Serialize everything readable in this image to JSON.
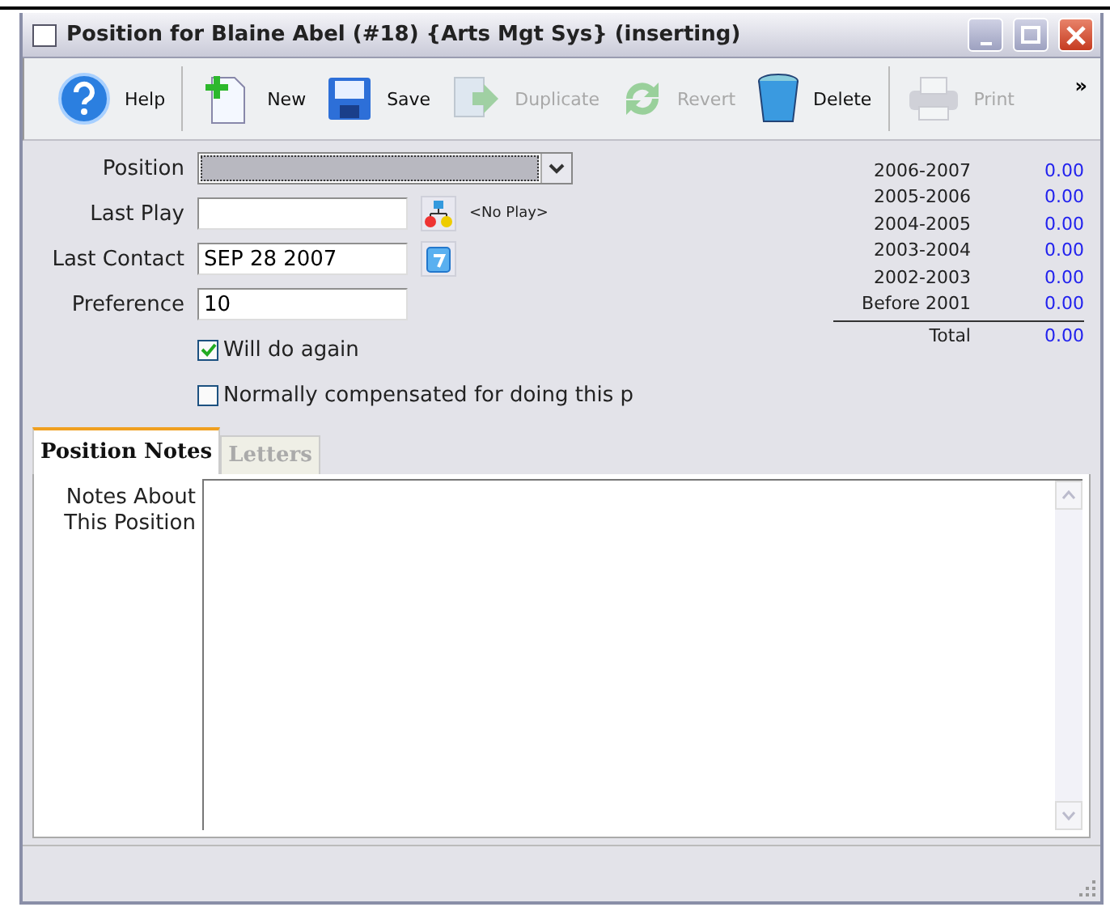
{
  "window": {
    "title": "Position for Blaine Abel (#18) {Arts Mgt Sys} (inserting)"
  },
  "toolbar": {
    "buttons": [
      {
        "label": "Help",
        "disabled": false
      },
      {
        "label": "New",
        "disabled": false
      },
      {
        "label": "Save",
        "disabled": false
      },
      {
        "label": "Duplicate",
        "disabled": true
      },
      {
        "label": "Revert",
        "disabled": true
      },
      {
        "label": "Delete",
        "disabled": false
      },
      {
        "label": "Print",
        "disabled": true
      }
    ],
    "overflow": "»"
  },
  "form": {
    "position": {
      "label": "Position"
    },
    "last_play": {
      "label": "Last Play",
      "link": "<No Play>"
    },
    "last_contact": {
      "label": "Last Contact",
      "value": "SEP 28 2007"
    },
    "preference": {
      "label": "Preference",
      "value": "10"
    },
    "checkboxes": [
      {
        "label": "Will do again",
        "checked": true
      },
      {
        "label": "Normally compensated for doing this p",
        "checked": false
      }
    ]
  },
  "seasons": {
    "rows": [
      {
        "label": "2006-2007",
        "value": "0.00"
      },
      {
        "label": "2005-2006",
        "value": "0.00"
      },
      {
        "label": "2004-2005",
        "value": "0.00"
      },
      {
        "label": "2003-2004",
        "value": "0.00"
      },
      {
        "label": "2002-2003",
        "value": "0.00"
      },
      {
        "label": "Before 2001",
        "value": "0.00"
      }
    ],
    "total": {
      "label": "Total",
      "value": "0.00"
    }
  },
  "tabs": [
    {
      "label": "Position Notes",
      "selected": true
    },
    {
      "label": "Letters",
      "selected": false
    }
  ],
  "notes": {
    "label": "Notes About This Position"
  }
}
